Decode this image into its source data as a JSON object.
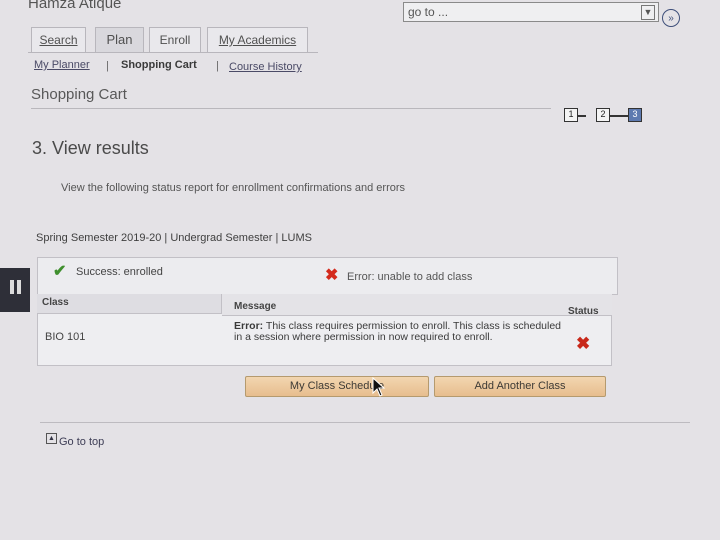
{
  "header": {
    "user_name": "Hamza Atique",
    "goto_value": "go to ...",
    "goto_button_icon": "double-chevron-right-icon"
  },
  "tabs": [
    {
      "label": "Search",
      "active": false
    },
    {
      "label": "Plan",
      "active": true
    },
    {
      "label": "Enroll",
      "active": false
    },
    {
      "label": "My Academics",
      "active": false
    }
  ],
  "subnav": {
    "planner": "My Planner",
    "separator": "|",
    "cart": "Shopping Cart",
    "history": "Course History"
  },
  "page_title": "Shopping Cart",
  "steps": [
    "1",
    "2",
    "3"
  ],
  "current_step": 3,
  "step_heading": "3.  View results",
  "instructions": "View the following status report for enrollment confirmations and errors",
  "term_info": "Spring Semester 2019-20 | Undergrad Semester | LUMS",
  "legend": {
    "success_icon": "check-icon",
    "success_label": "Success: enrolled",
    "error_icon": "x-icon",
    "error_label": "Error: unable to add class"
  },
  "table": {
    "columns": [
      "Class",
      "Message",
      "Status"
    ],
    "rows": [
      {
        "class": "BIO  101",
        "message_prefix": "Error:",
        "message_body": " This class requires permission to enroll. This class is scheduled in a session where permission in now required to enroll.",
        "status_icon": "x-icon"
      }
    ]
  },
  "buttons": {
    "schedule": "My Class Schedule",
    "add_another": "Add Another Class"
  },
  "footer": {
    "top_icon": "arrow-up-icon",
    "go_to_top": "Go to top"
  },
  "colors": {
    "success": "#3f8f2e",
    "error": "#d42a1c",
    "button": "#e9c498",
    "current_step": "#5d7ab0"
  }
}
